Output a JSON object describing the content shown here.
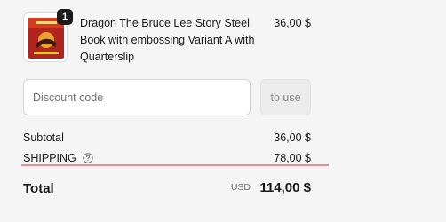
{
  "line_item": {
    "quantity": "1",
    "title": "Dragon The Bruce Lee Story Steel Book with embossing Variant A with Quarterslip",
    "price": "36,00 $",
    "thumbnail_icon": "steelbook-cover-thumbnail"
  },
  "discount": {
    "placeholder": "Discount code",
    "value": "",
    "apply_label": "to use"
  },
  "subtotal": {
    "label": "Subtotal",
    "value": "36,00 $"
  },
  "shipping": {
    "label": "SHIPPING",
    "help_icon": "question-circle-icon",
    "value": "78,00 $"
  },
  "total": {
    "label": "Total",
    "currency": "USD",
    "value": "114,00 $"
  },
  "colors": {
    "badge_bg": "#1a1a1a",
    "underline": "#ec8a92",
    "page_bg": "#f5f5f5"
  }
}
